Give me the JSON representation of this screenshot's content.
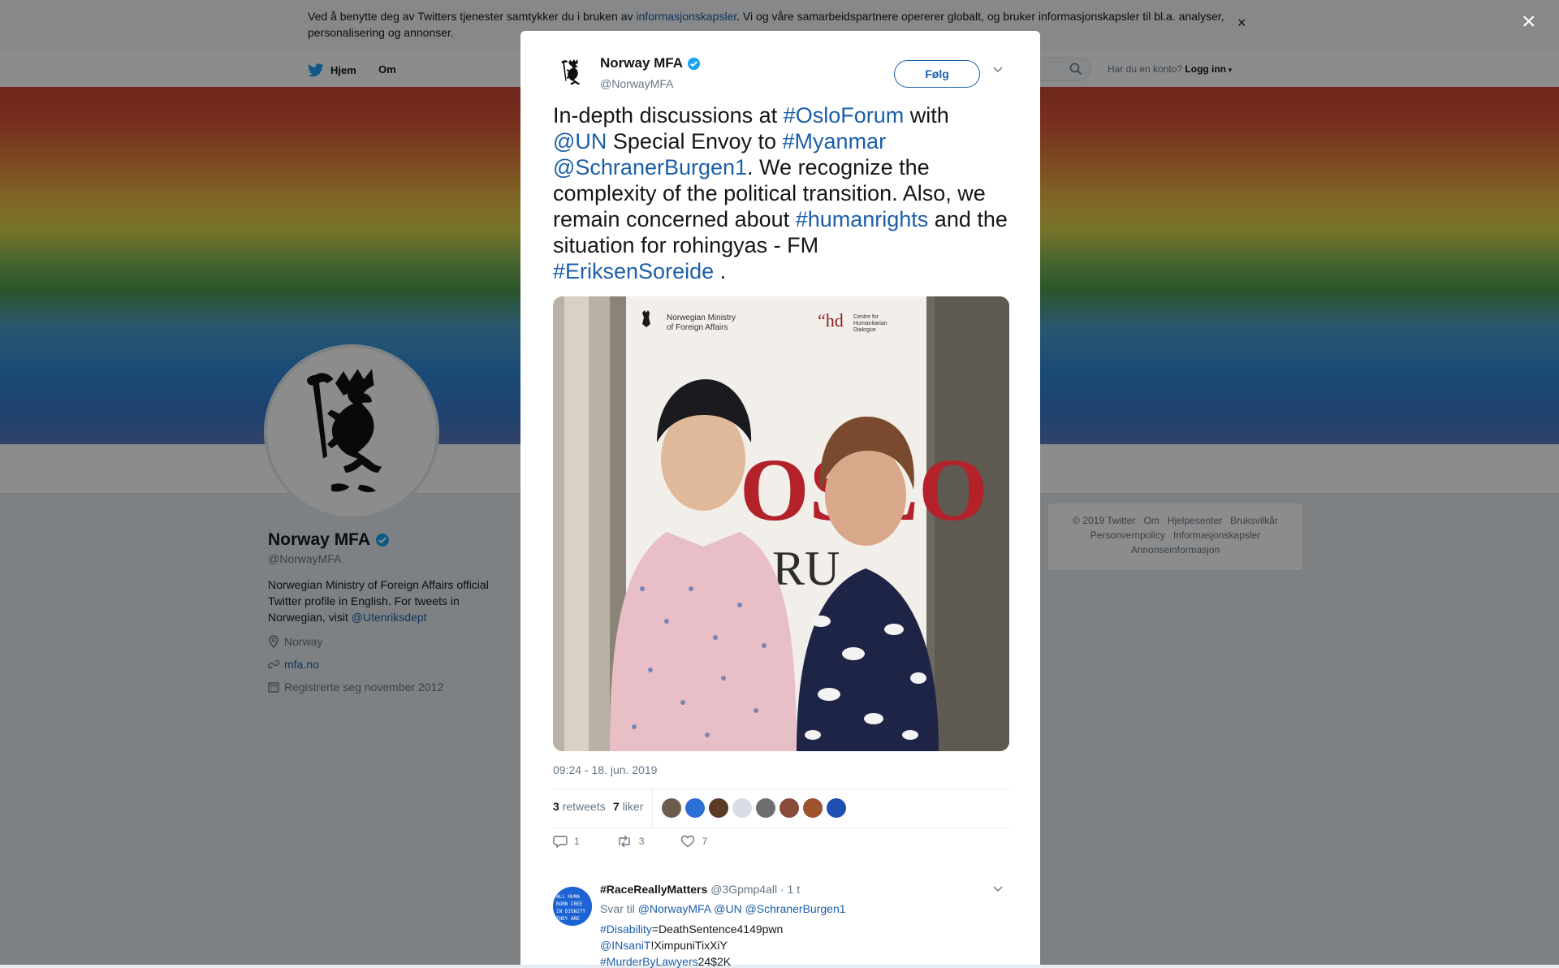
{
  "cookie": {
    "text_before": "Ved å benytte deg av Twitters tjenester samtykker du i bruken av ",
    "link": "informasjonskapsler",
    "text_after": ". Vi og våre samarbeidspartnere opererer globalt, og bruker informasjonskapsler til bl.a. analyser, personalisering og annonser.",
    "close": "×"
  },
  "nav": {
    "home": "Hjem",
    "about": "Om",
    "login_prompt": "Har du en konto?",
    "login": "Logg inn"
  },
  "profile": {
    "name": "Norway MFA",
    "handle": "@NorwayMFA",
    "bio": "Norwegian Ministry of Foreign Affairs official Twitter profile in English. For tweets in Norwegian, visit ",
    "bio_link": "@Utenriksdept",
    "location": "Norway",
    "website": "mfa.no",
    "joined": "Registrerte seg november 2012"
  },
  "footer": {
    "links_row1": [
      "© 2019 Twitter",
      "Om",
      "Hjelpesenter",
      "Bruksvilkår"
    ],
    "links_row2": [
      "Personvernpolicy",
      "Informasjonskapsler"
    ],
    "links_row3": [
      "Annonseinformasjon"
    ]
  },
  "modal_close": "×",
  "tweet": {
    "name": "Norway MFA",
    "handle": "@NorwayMFA",
    "follow": "Følg",
    "text": {
      "p1": "In-depth discussions at ",
      "h1": "#OsloForum",
      "p2": " with ",
      "h2": "@UN",
      "p3": " Special Envoy to ",
      "h3": "#Myanmar",
      "h4": "@SchranerBurgen1",
      "p4": ". We recognize the complexity of the political transition. Also, we remain concerned about ",
      "h5": "#humanrights",
      "p5": " and the situation for rohingyas - FM ",
      "h6": "#EriksenSoreide",
      "p6": " ."
    },
    "photo": {
      "banner_ministry": "Norwegian Ministry of Foreign Affairs",
      "banner_hd": "“hd",
      "banner_hd_sub": "Centre for Humanitarian Dialogue",
      "banner_big": "OSLO",
      "banner_big2": "RU"
    },
    "time": "09:24 - 18. jun. 2019",
    "retweets_count": "3",
    "retweets_label": "retweets",
    "likes_count": "7",
    "likes_label": "liker",
    "liker_colors": [
      "#6b5b4a",
      "#2b6fd6",
      "#5a3a28",
      "#d9dde3",
      "#6e6e6e",
      "#8a4a3a",
      "#a0522d",
      "#1f4fb0"
    ],
    "reply_count": "1",
    "retweet_action_count": "3",
    "like_action_count": "7"
  },
  "reply": {
    "name": "#RaceReallyMatters",
    "handle": "@3Gpmp4all",
    "time": "· 1 t",
    "reply_to_label": "Svar til",
    "reply_to": "@NorwayMFA @UN @SchranerBurgen1",
    "line1_tag": "#Disability",
    "line1_rest": "=DeathSentence4149pwn",
    "line2_tag": "@INsaniT",
    "line2_rest": "!XimpuniTixXiY",
    "line3_tag": "#MurderByLawyers",
    "line3_rest": "24$2K",
    "avatar_text": "ALL HUMA BORN FREE IN DIGNITY THEY ARE"
  }
}
